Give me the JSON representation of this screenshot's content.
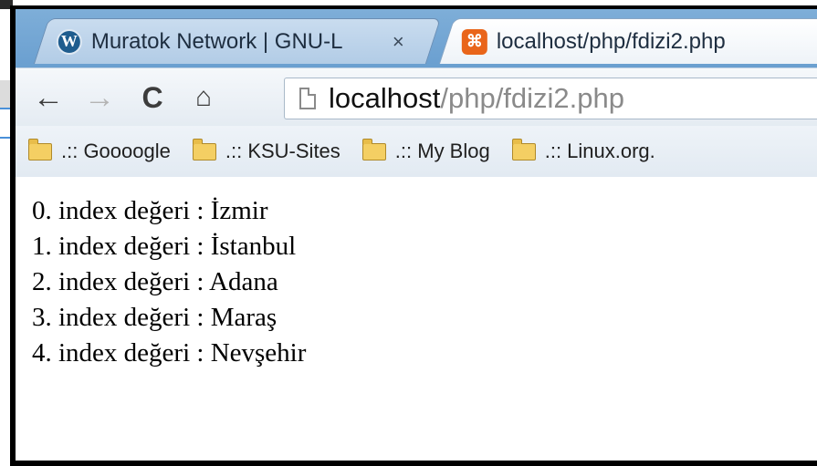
{
  "tabs": [
    {
      "title": "Muratok Network | GNU-L",
      "icon": "wordpress-icon",
      "close": "×"
    },
    {
      "title": "localhost/php/fdizi2.php",
      "icon": "xampp-icon"
    }
  ],
  "toolbar": {
    "back": "←",
    "forward": "→",
    "reload": "C",
    "home": "⌂"
  },
  "address": {
    "host": "localhost",
    "path": "/php/fdizi2.php"
  },
  "bookmarks": [
    {
      "label": ".:: Goooogle"
    },
    {
      "label": ".:: KSU-Sites"
    },
    {
      "label": ".:: My Blog"
    },
    {
      "label": ".:: Linux.org."
    }
  ],
  "content": {
    "lines": [
      "0. index değeri : İzmir",
      "1. index değeri : İstanbul",
      "2. index değeri : Adana",
      "3. index değeri : Maraş",
      "4. index değeri : Nevşehir"
    ]
  },
  "colors": {
    "frame": "#000000",
    "tab_strip": "#7eaed8",
    "xampp_orange": "#e9651a",
    "wordpress_blue": "#1f5d8e",
    "folder_yellow": "#f4cf63"
  }
}
